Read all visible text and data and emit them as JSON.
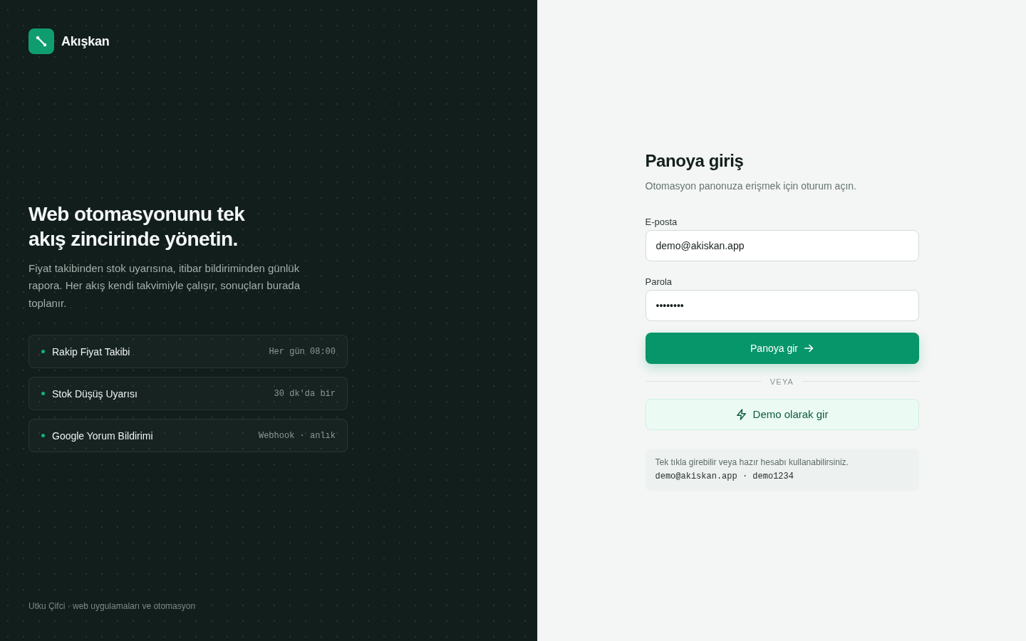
{
  "brand": {
    "name": "Akışkan"
  },
  "hero": {
    "title": "Web otomasyonunu tek akış zincirinde yönetin.",
    "description": "Fiyat takibinden stok uyarısına, itibar bildiriminden günlük rapora. Her akış kendi takvimiyle çalışır, sonuçları burada toplanır."
  },
  "flows": [
    {
      "name": "Rakip Fiyat Takibi",
      "schedule": "Her gün 08:00"
    },
    {
      "name": "Stok Düşüş Uyarısı",
      "schedule": "30 dk'da bir"
    },
    {
      "name": "Google Yorum Bildirimi",
      "schedule": "Webhook · anlık"
    }
  ],
  "footer": {
    "text": "Utku Çifci · web uygulamaları ve otomasyon"
  },
  "login": {
    "title": "Panoya giriş",
    "subtitle": "Otomasyon panonuza erişmek için oturum açın.",
    "fields": [
      {
        "label": "E-posta",
        "value": "demo@akiskan.app"
      },
      {
        "label": "Parola",
        "value": "••••••••"
      }
    ],
    "submit": "Panoya gir",
    "divider": "VEYA",
    "demo_button": "Demo olarak gir",
    "hint": {
      "text": "Tek tıkla girebilir veya hazır hesabı kullanabilirsiniz.",
      "credentials": "demo@akiskan.app · demo1234"
    }
  }
}
